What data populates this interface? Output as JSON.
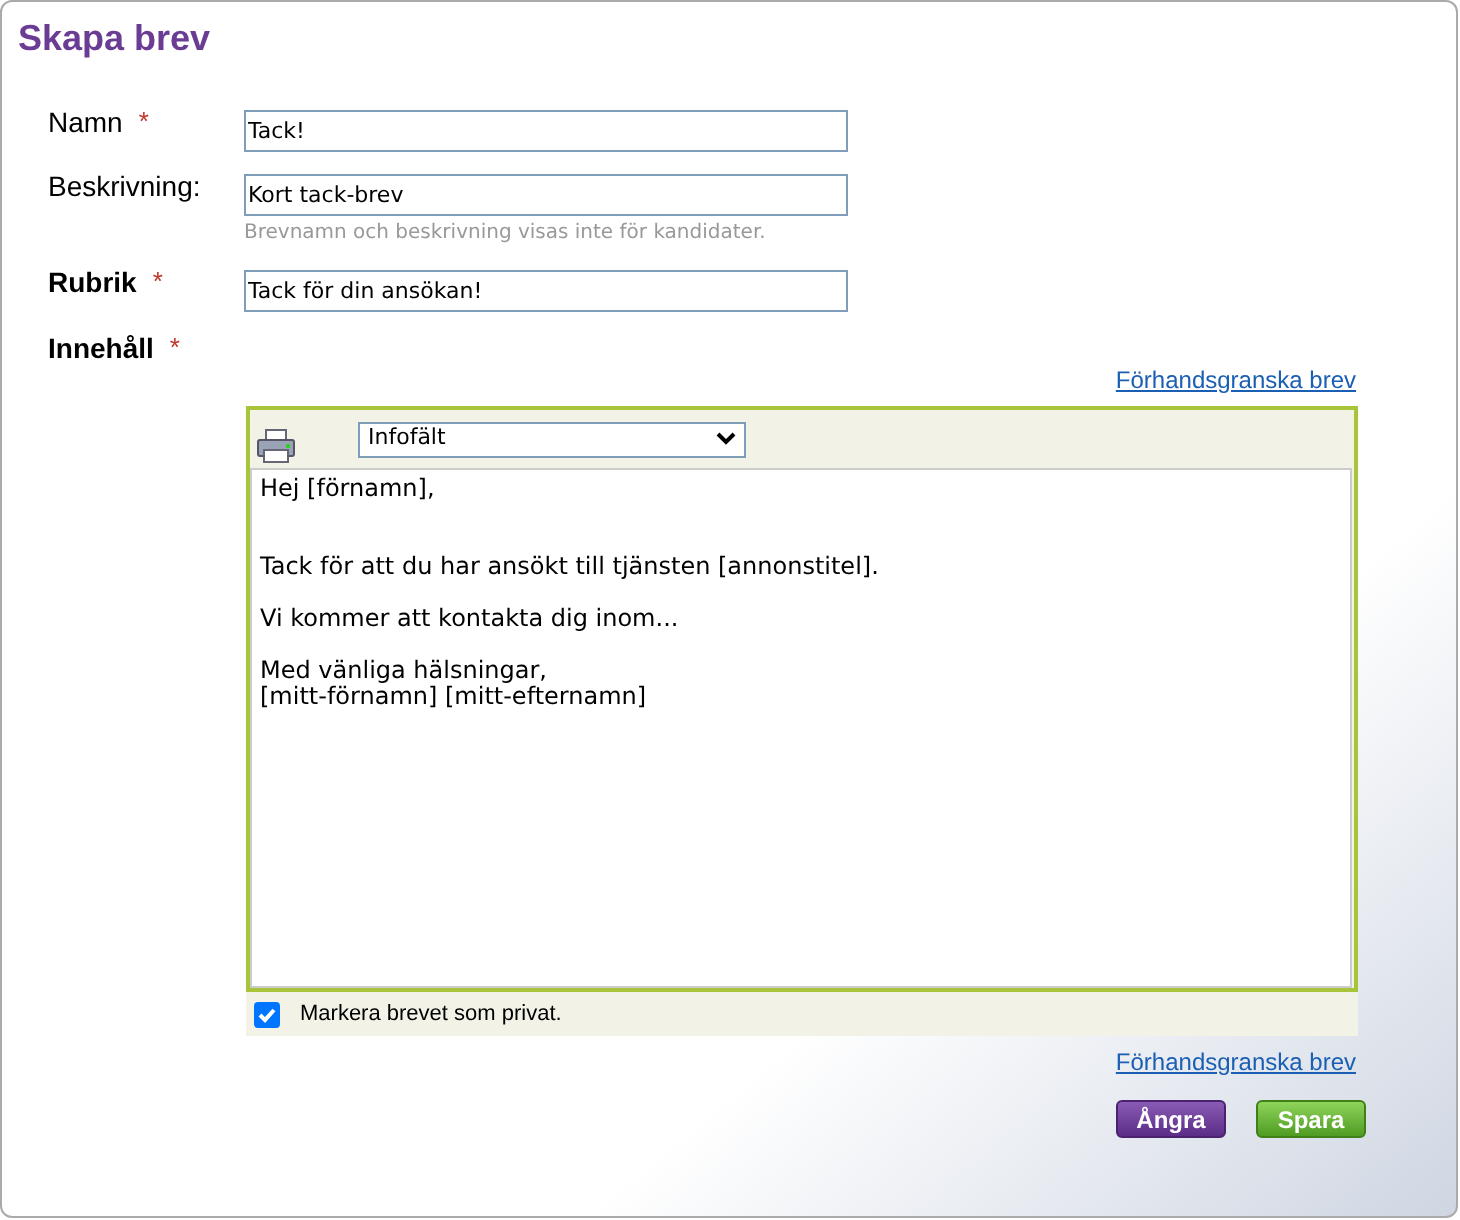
{
  "title": "Skapa brev",
  "fields": [
    {
      "label": "Namn",
      "required": true,
      "bold": false,
      "value": "Tack!"
    },
    {
      "label": "Beskrivning:",
      "required": false,
      "bold": false,
      "value": "Kort tack-brev",
      "hint": "Brevnamn och beskrivning visas inte för kandidater."
    },
    {
      "label": "Rubrik",
      "required": true,
      "bold": true,
      "value": "Tack för din ansökan!"
    }
  ],
  "content": {
    "label": "Innehåll",
    "required": true,
    "bold": true,
    "required_mark": "*",
    "preview_link": "Förhandsgranska brev",
    "dropdown": "Infofält",
    "paragraphs": [
      [
        "Hej [förnamn],"
      ],
      [
        "Tack för att du har ansökt till tjänsten [annonstitel]."
      ],
      [
        "Vi kommer att kontakta dig inom..."
      ],
      [
        "Med vänliga hälsningar,",
        "[mitt-förnamn] [mitt-efternamn]"
      ]
    ],
    "private": {
      "label": "Markera brevet som privat.",
      "checked": true
    }
  },
  "preview_link_bottom": "Förhandsgranska brev",
  "buttons": [
    {
      "label": "Ångra",
      "kind": "cancel"
    },
    {
      "label": "Spara",
      "kind": "save"
    }
  ]
}
